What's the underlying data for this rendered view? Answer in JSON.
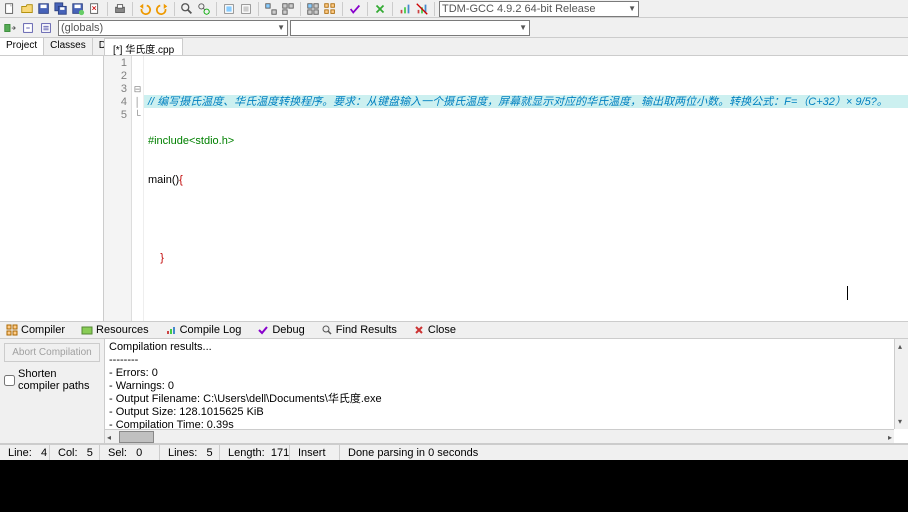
{
  "toolbar": {
    "compiler_combo": "TDM-GCC 4.9.2 64-bit Release"
  },
  "scope_combo": "(globals)",
  "panel_tabs": {
    "project": "Project",
    "classes": "Classes",
    "debug": "Debug"
  },
  "editor_tab": "[*] 华氏度.cpp",
  "code": {
    "line1_comment": "// 编写摄氏温度、华氏温度转换程序。要求：从键盘输入一个摄氏温度，屏幕就显示对应的华氏温度，输出取两位小数。转换公式：F=（C+32）× 9/5?。",
    "line2_include": "#include<stdio.h>",
    "line3_main": "main()",
    "line3_brace": "{",
    "line4": "",
    "line5_brace": "}"
  },
  "gutter": [
    "1",
    "2",
    "3",
    "4",
    "5"
  ],
  "bottom_tabs": {
    "compiler": "Compiler",
    "resources": "Resources",
    "compilelog": "Compile Log",
    "debug": "Debug",
    "findresults": "Find Results",
    "close": "Close"
  },
  "abort_btn": "Abort Compilation",
  "shorten_chk": "Shorten compiler paths",
  "output_lines": [
    "Compilation results...",
    "--------",
    "- Errors: 0",
    "- Warnings: 0",
    "- Output Filename: C:\\Users\\dell\\Documents\\华氏度.exe",
    "- Output Size: 128.1015625 KiB",
    "- Compilation Time: 0.39s"
  ],
  "status": {
    "line_lbl": "Line:",
    "line_val": "4",
    "col_lbl": "Col:",
    "col_val": "5",
    "sel_lbl": "Sel:",
    "sel_val": "0",
    "lines_lbl": "Lines:",
    "lines_val": "5",
    "length_lbl": "Length:",
    "length_val": "171",
    "mode": "Insert",
    "msg": "Done parsing in 0 seconds"
  }
}
